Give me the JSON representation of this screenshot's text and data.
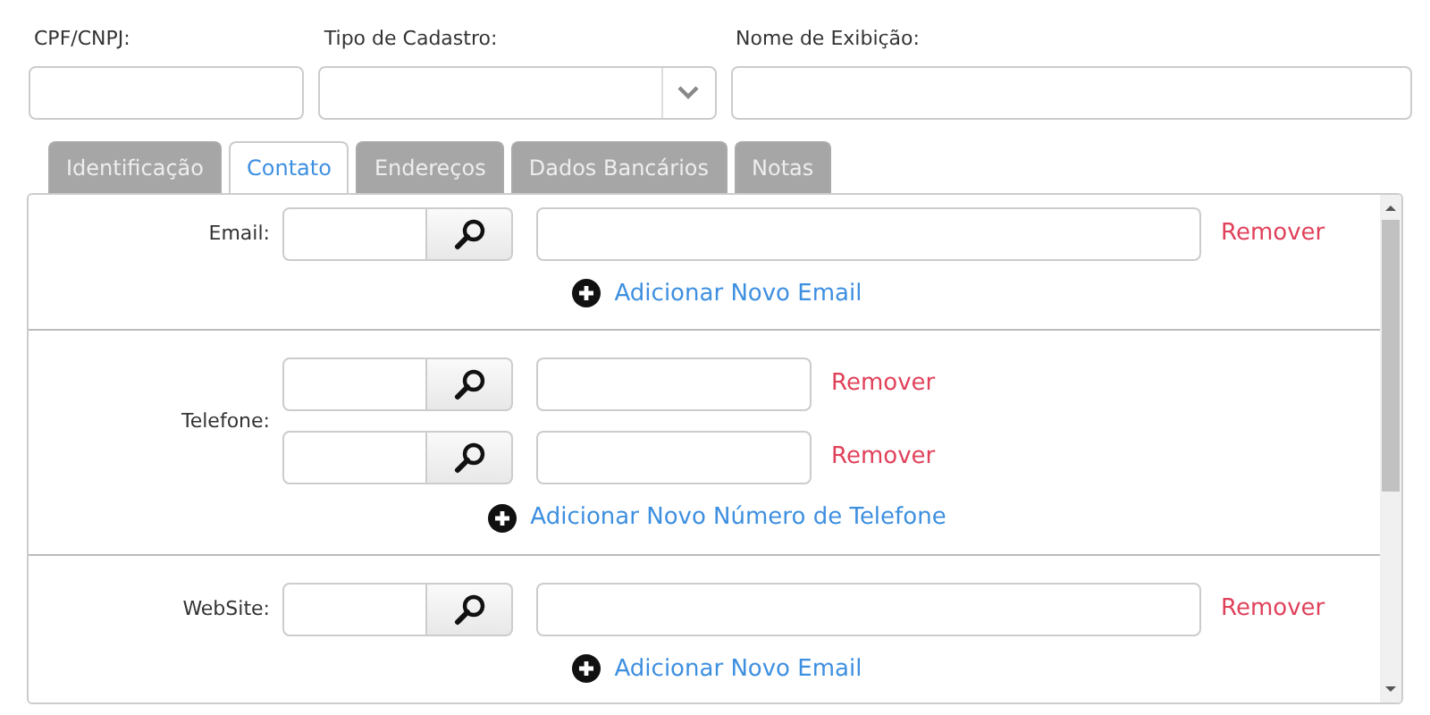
{
  "header_fields": [
    {
      "label": "CPF/CNPJ:",
      "kind": "text"
    },
    {
      "label": "Tipo de Cadastro:",
      "kind": "select"
    },
    {
      "label": "Nome de Exibição:",
      "kind": "text"
    }
  ],
  "tabs": [
    {
      "label": "Identificação",
      "selected": false
    },
    {
      "label": "Contato",
      "selected": true
    },
    {
      "label": "Endereços",
      "selected": false
    },
    {
      "label": "Dados Bancários",
      "selected": false
    },
    {
      "label": "Notas",
      "selected": false
    }
  ],
  "sections": [
    {
      "label": "Email:",
      "entries": [
        {
          "kind": "wide",
          "remove": "Remover"
        }
      ],
      "add_link": "Adicionar Novo Email"
    },
    {
      "label": "Telefone:",
      "entries": [
        {
          "kind": "narrow",
          "remove": "Remover"
        },
        {
          "kind": "narrow",
          "remove": "Remover"
        }
      ],
      "add_link": "Adicionar Novo Número de Telefone"
    },
    {
      "label": "WebSite:",
      "entries": [
        {
          "kind": "wide",
          "remove": "Remover"
        }
      ],
      "add_link": "Adicionar Novo Email"
    }
  ]
}
